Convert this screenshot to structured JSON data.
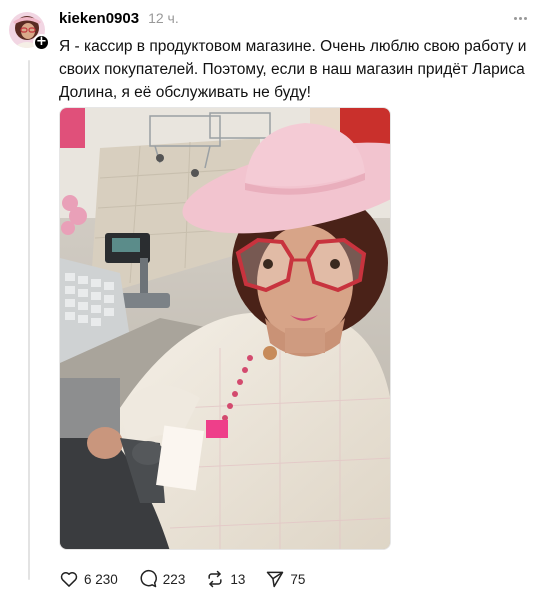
{
  "post": {
    "username": "kieken0903",
    "time": "12 ч.",
    "text": "Я - кассир в продуктовом магазине. Очень люблю свою работу и своих покупателей. Поэтому, если в наш магазин придёт Лариса Долина, я её обслуживать не буду!",
    "image_icon": "photo-selfie-cashier"
  },
  "actions": {
    "likes": "6 230",
    "comments": "223",
    "reposts": "13",
    "shares": "75"
  },
  "icons": {
    "like": "heart-icon",
    "comment": "comment-icon",
    "repost": "repost-icon",
    "share": "send-icon",
    "more": "more-icon",
    "follow": "plus-icon"
  },
  "colors": {
    "username": "#000000",
    "meta": "#999999",
    "thread_line": "#e3e3e3"
  }
}
